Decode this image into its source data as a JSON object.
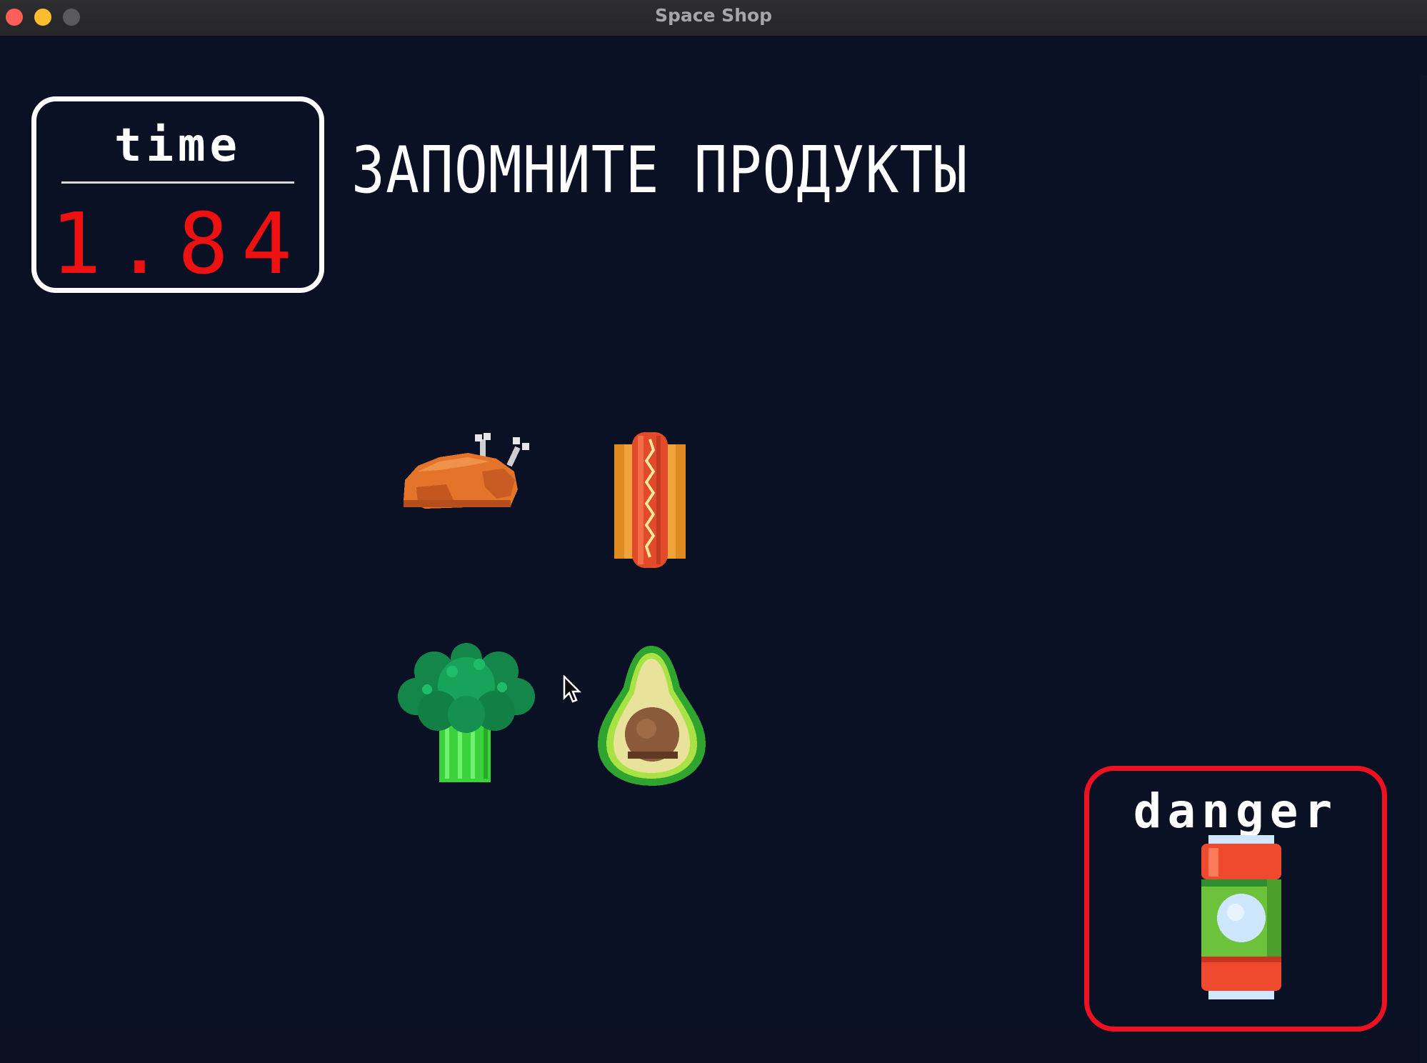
{
  "window": {
    "title": "Space Shop"
  },
  "timer": {
    "label": "time",
    "value": "1.84"
  },
  "instruction": "ЗАПОМНИТЕ ПРОДУКТЫ",
  "items": [
    {
      "name": "roast-chicken",
      "icon": "roast-chicken-icon"
    },
    {
      "name": "hot-dog",
      "icon": "hot-dog-icon"
    },
    {
      "name": "broccoli",
      "icon": "broccoli-icon"
    },
    {
      "name": "avocado",
      "icon": "avocado-icon"
    }
  ],
  "danger": {
    "label": "danger",
    "icon": "soda-can-icon"
  },
  "colors": {
    "background": "#0a1124",
    "timer_value": "#ee1111",
    "danger_border": "#ee1122"
  }
}
